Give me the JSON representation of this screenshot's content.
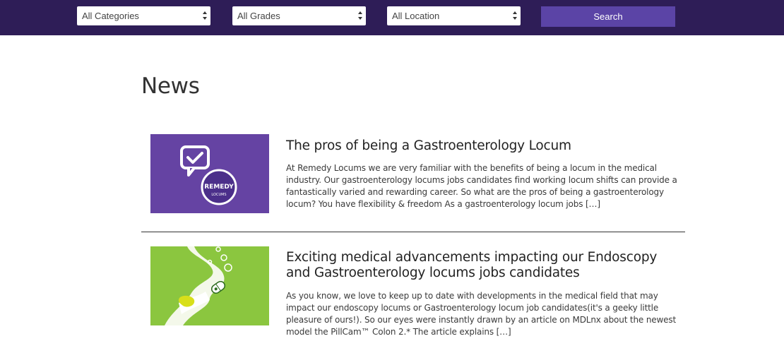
{
  "filters": {
    "categories": "All Categories",
    "grades": "All Grades",
    "location": "All Location",
    "search_label": "Search"
  },
  "page": {
    "title": "News"
  },
  "articles": [
    {
      "title": "The pros of being a Gastroenterology Locum",
      "excerpt": "At Remedy Locums we are very familiar with the benefits of being a locum in the medical industry. Our gastroenterology locums jobs candidates find working locum shifts can provide a fantastically varied and rewarding career. So what are the pros of being a gastroenterology locum? You have flexibility & freedom As a gastroenterology locum jobs […]",
      "thumb_logo_main": "REMEDY",
      "thumb_logo_sub": "LOCUMS",
      "thumb_bg": "#6a48a8"
    },
    {
      "title": "Exciting medical advancements impacting our Endoscopy and Gastroenterology locums jobs candidates",
      "excerpt": "As you know, we love to keep up to date with developments in the medical field that may impact our endoscopy locums or Gastroenterology locum job candidates(it's a geeky little pleasure of ours!). So our eyes were instantly drawn by an article on MDLnx about the newest model the PillCam™ Colon 2.* The article explains […]",
      "thumb_bg": "#8bc63f"
    }
  ],
  "colors": {
    "topbar": "#2e1d57",
    "search_button": "#5b44a6"
  }
}
